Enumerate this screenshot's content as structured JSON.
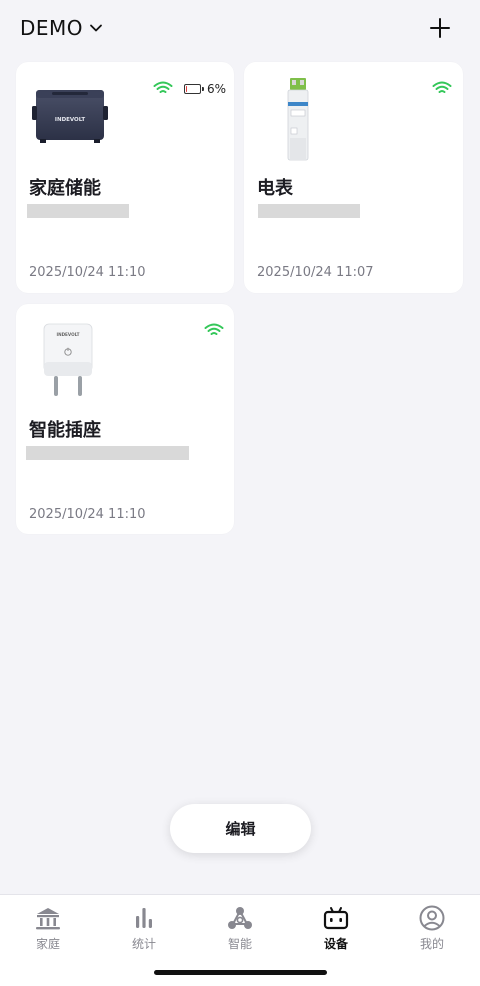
{
  "header": {
    "home_name": "DEMO",
    "chevron_icon": "chevron-down-icon",
    "add_icon": "plus-icon"
  },
  "devices": [
    {
      "name": "家庭储能",
      "time": "2025/10/24 11:10",
      "online": true,
      "battery_percent": 6,
      "battery_text": "6%",
      "brand_label": "INDEVOLT",
      "icon": "power-station-image"
    },
    {
      "name": "电表",
      "time": "2025/10/24 11:07",
      "online": true,
      "icon": "energy-meter-image"
    },
    {
      "name": "智能插座",
      "time": "2025/10/24 11:10",
      "online": true,
      "brand_label": "INDEVOLT",
      "icon": "smart-plug-image"
    }
  ],
  "edit_button": {
    "label": "编辑"
  },
  "tabbar": {
    "active": "设备",
    "tabs": [
      {
        "label": "家庭",
        "icon": "home-icon"
      },
      {
        "label": "统计",
        "icon": "bar-chart-icon"
      },
      {
        "label": "智能",
        "icon": "scene-nodes-icon"
      },
      {
        "label": "设备",
        "icon": "device-icon"
      },
      {
        "label": "我的",
        "icon": "profile-icon"
      }
    ]
  },
  "colors": {
    "background": "#f4f4f8",
    "card": "#ffffff",
    "wifi": "#34c759",
    "battery_low": "#e04040",
    "placeholder_bar": "#d9d9d9",
    "tab_inactive": "#888890",
    "tab_active": "#111111"
  }
}
